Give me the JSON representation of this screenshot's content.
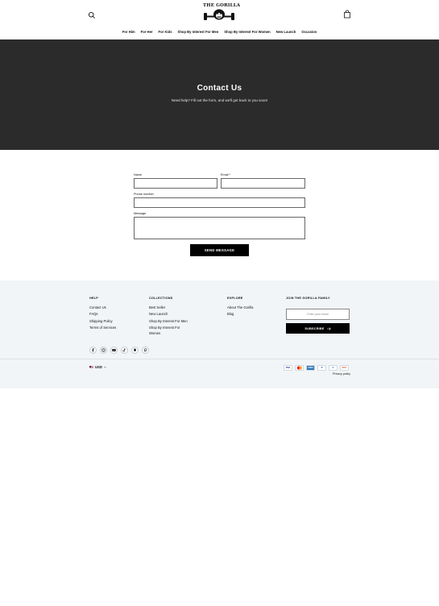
{
  "header": {
    "logo_text": "THE GORILLA",
    "nav": [
      "For Him",
      "For Her",
      "For Kids",
      "Shop By Interest For Men",
      "Shop By Interest For Women",
      "New Launch",
      "Occasion"
    ]
  },
  "hero": {
    "title": "Contact Us",
    "subtitle": "Need help? Fill out the form, and we'll get back to you soon!"
  },
  "form": {
    "name_label": "Name",
    "email_label": "Email *",
    "phone_label": "Phone number",
    "message_label": "Message",
    "send_label": "SEND MESSAGE"
  },
  "footer": {
    "help": {
      "title": "HELP",
      "links": [
        "Contact Us",
        "FAQs",
        "Shipping Policy",
        "Terms of Services"
      ]
    },
    "collections": {
      "title": "COLLECTIONS",
      "links": [
        "Best Seller",
        "New Launch",
        "Shop By Interest For Men",
        "Shop By Interest For",
        "Women"
      ]
    },
    "explore": {
      "title": "EXPLORE",
      "links": [
        "About The Gorilla",
        "Blog"
      ]
    },
    "newsletter": {
      "title": "JOIN THE GORILLA FAMILY",
      "placeholder": "Enter your email",
      "button": "SUBSCRIBE"
    },
    "socials": [
      "facebook-icon",
      "instagram-icon",
      "youtube-icon",
      "tiktok-icon",
      "snapchat-icon",
      "pinterest-icon"
    ],
    "currency": "USD",
    "payments": [
      "VISA",
      "MC",
      "AMEX",
      "P",
      "D",
      "DISC"
    ],
    "privacy": "Privacy policy"
  },
  "colors": {
    "hero_bg": "#2b2b2b",
    "footer_bg": "#f2f5f7",
    "button_bg": "#000000"
  }
}
